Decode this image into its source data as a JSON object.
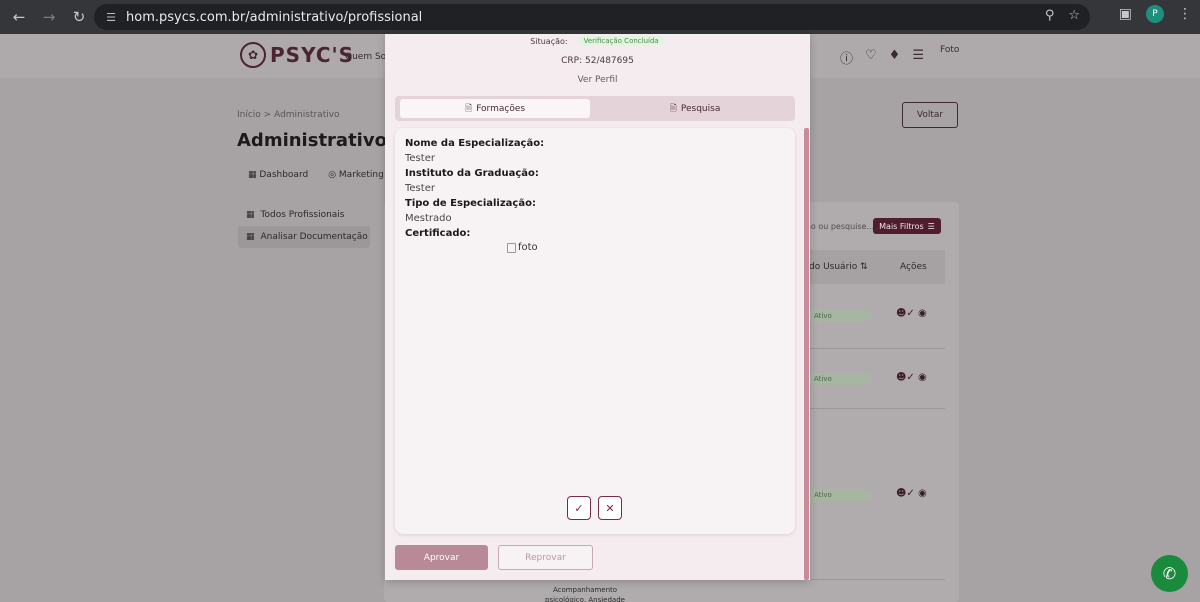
{
  "browser": {
    "url": "hom.psycs.com.br/administrativo/profissional",
    "profile_initial": "P"
  },
  "site": {
    "logo_text": "PSYC'S",
    "nav_quem": "Quem So",
    "avatar_alt": "Foto"
  },
  "page": {
    "breadcrumb": "Início > Administrativo",
    "title": "Administrativo",
    "voltar_label": "Voltar",
    "tabs": [
      "Dashboard",
      "Marketing"
    ],
    "sidebar": [
      "Todos Profissionais",
      "Analisar Documentação"
    ],
    "search_placeholder": "ão ou pesquise...",
    "filtros_label": "Mais Filtros",
    "table_headers": {
      "usuario": "do Usuário",
      "acoes": "Ações"
    },
    "row_status": [
      "Ativo",
      "Ativo",
      "Ativo"
    ],
    "bottom_text": "Acompanhamento psicológico, Ansiedade"
  },
  "modal": {
    "situacao_label": "Situação:",
    "situacao_badge": "Verificação Concluída",
    "crp": "CRP: 52/487695",
    "ver_perfil": "Ver Perfil",
    "tabs": {
      "formacoes": "Formações",
      "pesquisa": "Pesquisa"
    },
    "fields": {
      "especializacao_label": "Nome da Especialização:",
      "especializacao_value": "Tester",
      "instituto_label": "Instituto da Graduação:",
      "instituto_value": "Tester",
      "tipo_label": "Tipo de Especialização:",
      "tipo_value": "Mestrado",
      "certificado_label": "Certificado:",
      "certificado_img_alt": "foto"
    },
    "aprovar_label": "Aprovar",
    "reprovar_label": "Reprovar"
  }
}
